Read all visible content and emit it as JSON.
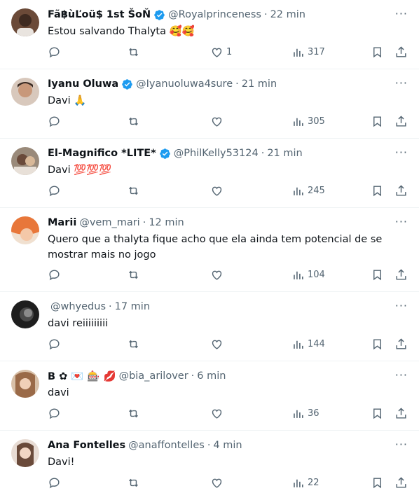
{
  "tweets": [
    {
      "name": "Fã฿ùĽoü$ 1st ŠoŇ",
      "verified": true,
      "handle": "@Royalprinceness",
      "time": "22 min",
      "text": "Estou salvando Thalyta 🥰🥰",
      "likes": "1",
      "views": "317",
      "avatar_color": "#5a3a2a"
    },
    {
      "name": "Iyanu Oluwa",
      "verified": true,
      "handle": "@Iyanuoluwa4sure",
      "time": "21 min",
      "text": "Davi 🙏",
      "likes": "",
      "views": "305",
      "avatar_color": "#c89a7a"
    },
    {
      "name": "El-Magnifico *LITE*",
      "verified": true,
      "handle": "@PhilKelly53124",
      "time": "21 min",
      "text": "Davi 💯💯💯",
      "likes": "",
      "views": "245",
      "avatar_color": "#7a5a4a"
    },
    {
      "name": "Marii",
      "verified": false,
      "handle": "@vem_mari",
      "time": "12 min",
      "text": "Quero que a thalyta fique acho que ela ainda tem potencial de se mostrar mais no jogo",
      "likes": "",
      "views": "104",
      "avatar_color": "#e07a3a"
    },
    {
      "name": "",
      "verified": false,
      "handle": "@whyedus",
      "time": "17 min",
      "text": "davi reiiiiiiiii",
      "likes": "",
      "views": "144",
      "avatar_color": "#2a2a2a"
    },
    {
      "name": "B ✿ 💌 🎰 💋",
      "verified": false,
      "handle": "@bia_arilover",
      "time": "6 min",
      "text": "davi",
      "likes": "",
      "views": "36",
      "avatar_color": "#b08060"
    },
    {
      "name": "Ana Fontelles",
      "verified": false,
      "handle": "@anaffontelles",
      "time": "4 min",
      "text": "Davi!",
      "likes": "",
      "views": "22",
      "avatar_color": "#a08070"
    }
  ],
  "sep": "·",
  "more": "···",
  "colors": {
    "verified": "#1d9bf0",
    "muted": "#536471",
    "text": "#0f1419"
  }
}
